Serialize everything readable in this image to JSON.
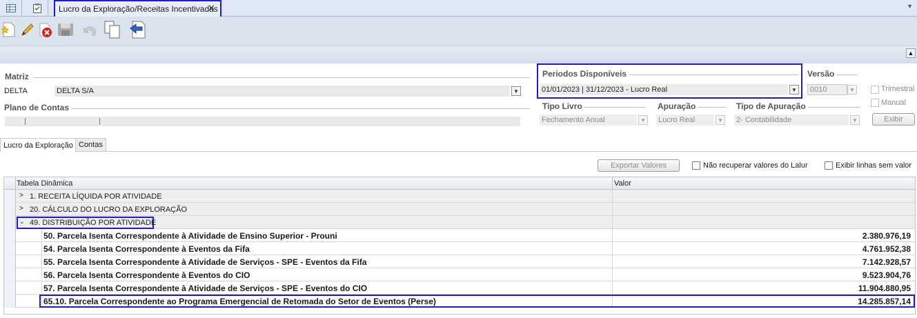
{
  "doc_tab": {
    "title": "Lucro da Exploração/Receitas Incentivadas",
    "close": "✕"
  },
  "filters": {
    "matriz_label": "Matriz",
    "matriz_code": "DELTA",
    "matriz_name": "DELTA S/A",
    "plano_label": "Plano de Contas",
    "periodos_label": "Periodos Disponíveis",
    "periodos_value": "01/01/2023 | 31/12/2023 - Lucro Real",
    "versao_label": "Versão",
    "versao_value": "0010",
    "trimestral_label": "Trimestral",
    "manual_label": "Manual",
    "tipo_livro_label": "Tipo Livro",
    "tipo_livro_value": "Fechamento Anual",
    "apuracao_label": "Apuração",
    "apuracao_value": "Lucro Real",
    "tipo_apuracao_label": "Tipo de Apuração",
    "tipo_apuracao_value": "2- Contabilidade",
    "exibir_button": "Exibir"
  },
  "inner_tabs": [
    "Lucro da Exploração",
    "Contas"
  ],
  "grid_toolbar": {
    "exportar_button": "Exportar Valores",
    "nao_recuperar_label": "Não recuperar valores do Lalur",
    "exibir_linhas_label": "Exibir linhas sem valor"
  },
  "grid": {
    "columns": [
      "Tabela Dinâmica",
      "Valor"
    ],
    "groups": [
      {
        "label": "1. RECEITA LÍQUIDA POR ATIVIDADE",
        "expanded": false
      },
      {
        "label": "20. CÁLCULO DO LUCRO DA EXPLORAÇÃO",
        "expanded": false
      },
      {
        "label": "49. DISTRIBUIÇÃO POR ATIVIDADE",
        "expanded": true
      }
    ],
    "rows": [
      {
        "label": "50. Parcela Isenta Correspondente à Atividade de Ensino Superior - Prouni",
        "value": "2.380.976,19"
      },
      {
        "label": "54. Parcela Isenta Correspondente à Eventos da Fifa",
        "value": "4.761.952,38"
      },
      {
        "label": "55. Parcela Isenta Correspondente à Atividade de Serviços - SPE - Eventos da Fifa",
        "value": "7.142.928,57"
      },
      {
        "label": "56. Parcela Isenta Correspondente à Eventos do CIO",
        "value": "9.523.904,76"
      },
      {
        "label": "57. Parcela Isenta Correspondente à Atividade de Serviços - SPE - Eventos do CIO",
        "value": "11.904.880,95"
      },
      {
        "label": "65.10. Parcela Correspondente ao Programa Emergencial de Retomada do Setor de Eventos (Perse)",
        "value": "14.285.857,14"
      }
    ]
  },
  "colors": {
    "highlight": "#1a1ae0",
    "toolbar": "#dbe3ef",
    "tabstrip": "#dfe8f6"
  }
}
